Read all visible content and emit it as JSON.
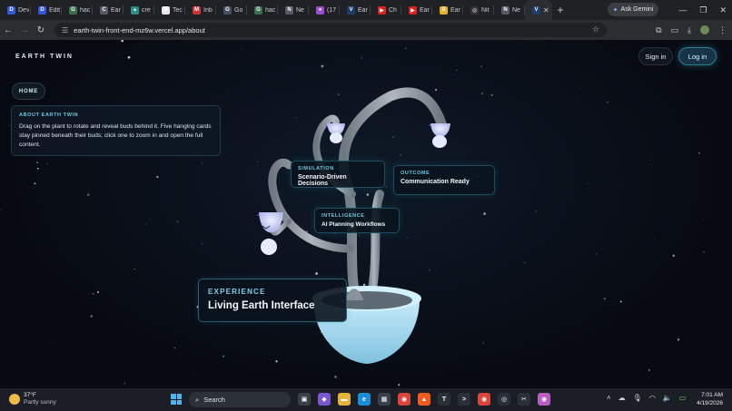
{
  "browser": {
    "tabs": [
      {
        "title": "Dev",
        "favicon": "D",
        "color": "#2f5ae0"
      },
      {
        "title": "Edit",
        "favicon": "D",
        "color": "#2f5ae0"
      },
      {
        "title": "hac",
        "favicon": "G",
        "color": "#3a6f4e"
      },
      {
        "title": "Ear",
        "favicon": "C",
        "color": "#555b66"
      },
      {
        "title": "cre",
        "favicon": "✦",
        "color": "#2a8f86"
      },
      {
        "title": "Tec",
        "favicon": "B",
        "color": "#e8e8e8"
      },
      {
        "title": "Inb",
        "favicon": "M",
        "color": "#c33"
      },
      {
        "title": "Go",
        "favicon": "G",
        "color": "#4a5060"
      },
      {
        "title": "hac",
        "favicon": "G",
        "color": "#3a6f4e"
      },
      {
        "title": "Ne",
        "favicon": "N",
        "color": "#555b66"
      },
      {
        "title": "(17",
        "favicon": "●",
        "color": "#9f4bd1"
      },
      {
        "title": "Ear",
        "favicon": "V",
        "color": "#1d3c70"
      },
      {
        "title": "Ch",
        "favicon": "▶",
        "color": "#d22"
      },
      {
        "title": "Ear",
        "favicon": "▶",
        "color": "#d22"
      },
      {
        "title": "Ear",
        "favicon": "S",
        "color": "#e3b12b"
      },
      {
        "title": "Nit",
        "favicon": "◎",
        "color": "#333"
      },
      {
        "title": "Ne",
        "favicon": "N",
        "color": "#555b66"
      }
    ],
    "active_tab_favicon": "V",
    "ask_gemini": "Ask Gemini",
    "url": "earth-twin-front-end-mz6w.vercel.app/about"
  },
  "header": {
    "brand": "EARTH TWIN",
    "sign_in": "Sign in",
    "log_in": "Log in"
  },
  "home_button": "HOME",
  "about": {
    "heading": "ABOUT EARTH TWIN",
    "body": "Drag on the plant to rotate and reveal buds behind it. Five hanging cards stay pinned beneath their buds; click one to zoom in and open the full content."
  },
  "cards": {
    "simulation": {
      "label": "SIMULATION",
      "value": "Scenario-Driven Decisions"
    },
    "outcome": {
      "label": "OUTCOME",
      "value": "Communication Ready"
    },
    "intelligence": {
      "label": "INTELLIGENCE",
      "value": "AI Planning Workflows"
    },
    "experience": {
      "label": "EXPERIENCE",
      "value": "Living Earth Interface"
    }
  },
  "taskbar": {
    "temperature": "37°F",
    "conditions": "Partly sunny",
    "search": "Search",
    "time": "7:01 AM",
    "date": "4/19/2026"
  },
  "colors": {
    "accent": "#6fc6e0",
    "page_bg": "#070a12",
    "card_border": "#1c4d5e",
    "pot": "#9fd6ee",
    "stem": "#8a939c",
    "bud": "#c8c0f0"
  }
}
